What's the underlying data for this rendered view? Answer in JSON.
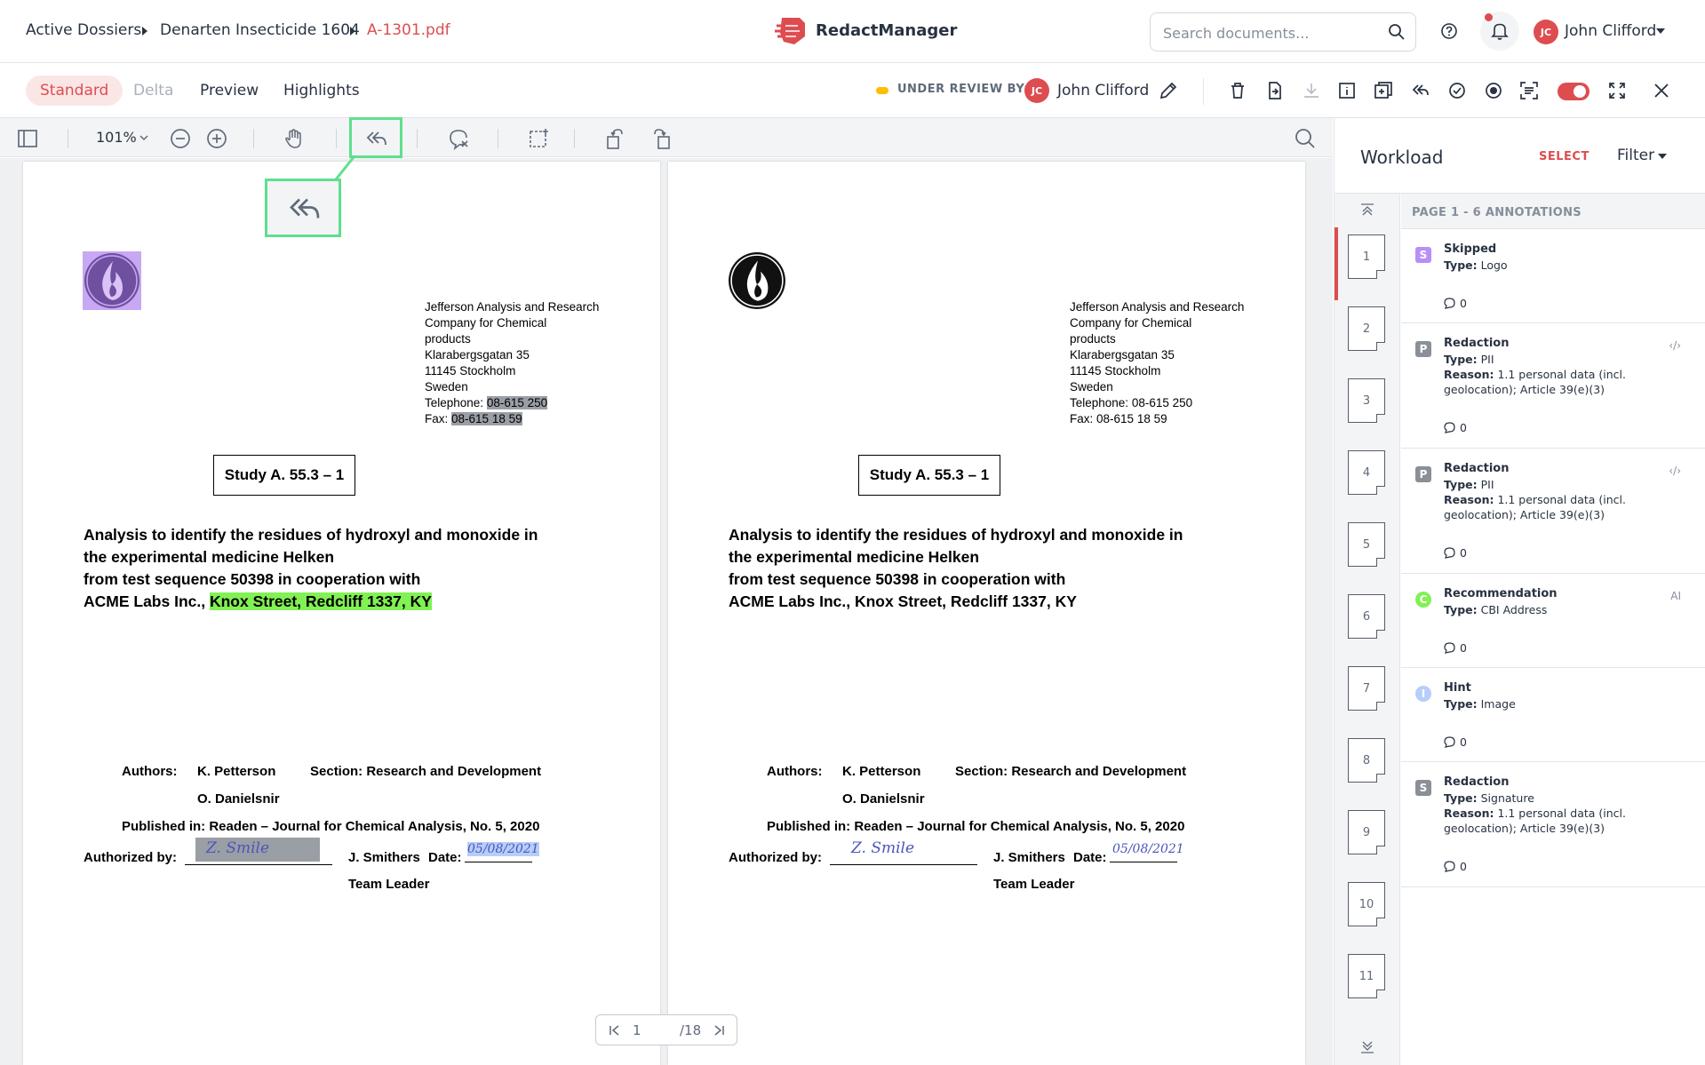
{
  "breadcrumb": {
    "items": [
      "Active Dossiers",
      "Denarten Insecticide 1604"
    ],
    "current": "A-1301.pdf"
  },
  "brand": {
    "name": "RedactManager"
  },
  "search": {
    "placeholder": "Search documents..."
  },
  "user": {
    "initials": "JC",
    "name": "John Clifford"
  },
  "modes": {
    "tabs": [
      "Standard",
      "Delta",
      "Preview",
      "Highlights"
    ],
    "active": "Standard"
  },
  "review": {
    "label": "UNDER REVIEW BY:",
    "initials": "JC",
    "name": "John Clifford"
  },
  "toolbar": {
    "zoom": "101%"
  },
  "document": {
    "address_lines": [
      "Jefferson Analysis and Research",
      "Company for Chemical",
      "products",
      "Klarabergsgatan 35",
      "11145 Stockholm",
      "Sweden"
    ],
    "telephone_label": "Telephone:",
    "telephone_value": "08-615 250",
    "fax_label": "Fax:",
    "fax_value": "08-615 18 59",
    "study": "Study A. 55.3 – 1",
    "title_lines": [
      "Analysis to identify the residues of hydroxyl and monoxide in",
      "the experimental medicine Helken",
      "from test sequence 50398 in cooperation with"
    ],
    "title_last_prefix": "ACME Labs Inc., ",
    "title_last_address": "Knox Street, Redcliff 1337, KY",
    "authors_label": "Authors:",
    "author1": "K. Petterson",
    "author2": "O. Danielsnir",
    "section": "Section: Research and Development",
    "published": "Published in: Readen – Journal for Chemical Analysis, No. 5, 2020",
    "authorized_label": "Authorized by:",
    "authorizer": "J. Smithers",
    "date_label": "Date:",
    "date_value": "05/08/2021",
    "role": "Team Leader",
    "signature_text": "Z. Smile"
  },
  "pagination": {
    "current": "1",
    "total": "/18"
  },
  "panel": {
    "title": "Workload",
    "select_label": "SELECT",
    "filter_label": "Filter",
    "page_header": "PAGE 1 - 6 ANNOTATIONS",
    "pages": [
      "1",
      "2",
      "3",
      "4",
      "5",
      "6",
      "7",
      "8",
      "9",
      "10",
      "11"
    ],
    "annotations": [
      {
        "badge": "S",
        "title": "Skipped",
        "type_label": "Type:",
        "type": "Logo",
        "reason_label": "",
        "reason1": "",
        "reason2": "",
        "comments": "0",
        "flag": "",
        "color": "#b98ef7"
      },
      {
        "badge": "P",
        "title": "Redaction",
        "type_label": "Type:",
        "type": "PII",
        "reason_label": "Reason:",
        "reason1": "1.1 personal data (incl.",
        "reason2": "geolocation); Article 39(e)(3)",
        "comments": "0",
        "flag": "‹/›",
        "color": "#8a8f98"
      },
      {
        "badge": "P",
        "title": "Redaction",
        "type_label": "Type:",
        "type": "PII",
        "reason_label": "Reason:",
        "reason1": "1.1 personal data (incl.",
        "reason2": "geolocation); Article 39(e)(3)",
        "comments": "0",
        "flag": "‹/›",
        "color": "#8a8f98"
      },
      {
        "badge": "C",
        "title": "Recommendation",
        "type_label": "Type:",
        "type": "CBI Address",
        "reason_label": "",
        "reason1": "",
        "reason2": "",
        "comments": "0",
        "flag": "AI",
        "color": "#81f153"
      },
      {
        "badge": "I",
        "title": "Hint",
        "type_label": "Type:",
        "type": "Image",
        "reason_label": "",
        "reason1": "",
        "reason2": "",
        "comments": "0",
        "flag": "",
        "color": "#b7cdfa"
      },
      {
        "badge": "S",
        "title": "Redaction",
        "type_label": "Type:",
        "type": "Signature",
        "reason_label": "Reason:",
        "reason1": "1.1 personal data (incl.",
        "reason2": "geolocation); Article 39(e)(3)",
        "comments": "0",
        "flag": "",
        "color": "#8a8f98"
      }
    ]
  },
  "colors": {
    "accent": "#dd4d50",
    "highlight_green": "#81f153",
    "callout": "#5ee08d",
    "status_yellow": "#fdbd00"
  }
}
